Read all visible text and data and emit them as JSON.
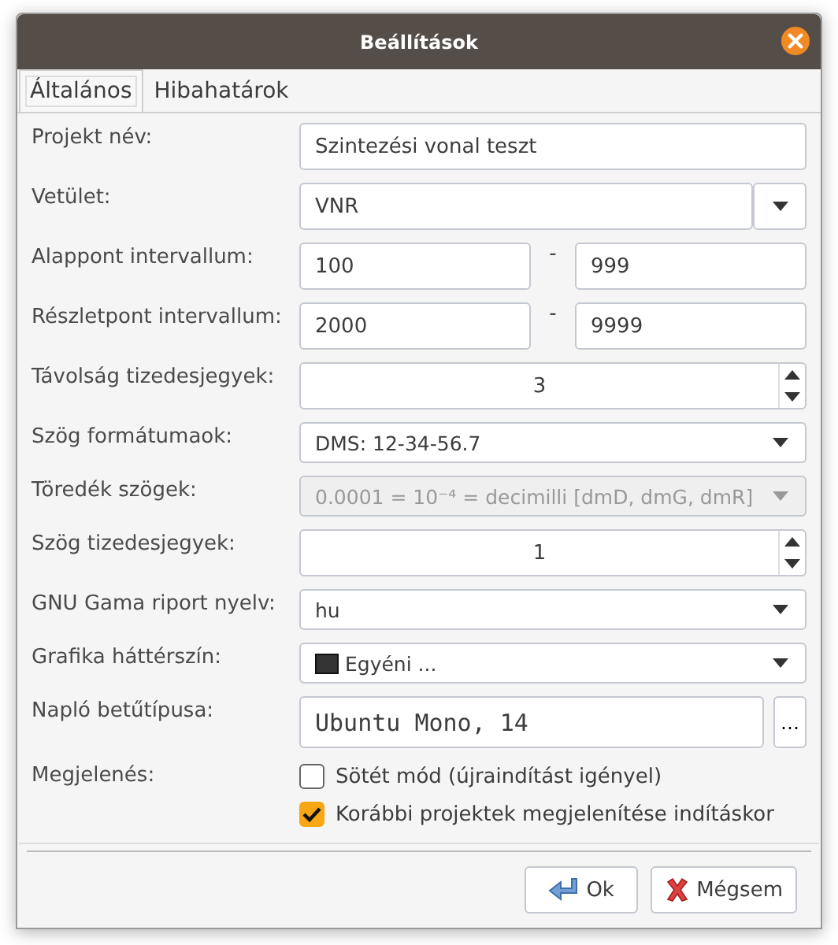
{
  "window": {
    "title": "Beállítások"
  },
  "tabs": [
    {
      "label": "Általános",
      "selected": true
    },
    {
      "label": "Hibahatárok",
      "selected": false
    }
  ],
  "fields": [
    {
      "kind": "text",
      "label": "Projekt név:",
      "value": "Szintezési vonal teszt"
    },
    {
      "kind": "combo",
      "label": "Vetület:",
      "value": "VNR"
    },
    {
      "kind": "range",
      "label": "Alappont intervallum:",
      "from": "100",
      "separator": "-",
      "to": "999"
    },
    {
      "kind": "range",
      "label": "Részletpont intervallum:",
      "from": "2000",
      "separator": "-",
      "to": "9999"
    },
    {
      "kind": "spin",
      "label": "Távolság tizedesjegyek:",
      "value": "3"
    },
    {
      "kind": "select",
      "label": "Szög formátumaok:",
      "value": "DMS: 12-34-56.7",
      "disabled": false
    },
    {
      "kind": "select",
      "label": "Töredék szögek:",
      "value": "0.0001 = 10⁻⁴ = decimilli [dmD, dmG, dmR]",
      "disabled": true
    },
    {
      "kind": "spin",
      "label": "Szög tizedesjegyek:",
      "value": "1"
    },
    {
      "kind": "select",
      "label": "GNU Gama riport nyelv:",
      "value": "hu",
      "disabled": false
    },
    {
      "kind": "color",
      "label": "Grafika háttérszín:",
      "value": "Egyéni ...",
      "color": "#333333"
    },
    {
      "kind": "font",
      "label": "Napló betűtípusa:",
      "value": "Ubuntu Mono, 14",
      "button": "…"
    },
    {
      "kind": "checks",
      "label": "Megjelenés:",
      "options": [
        {
          "label": "Sötét mód (újraindítást igényel)",
          "checked": false
        },
        {
          "label": "Korábbi projektek megjelenítése indításkor",
          "checked": true
        }
      ]
    }
  ],
  "buttons": [
    {
      "kind": "ok",
      "label": "Ok"
    },
    {
      "kind": "cancel",
      "label": "Mégsem"
    }
  ]
}
